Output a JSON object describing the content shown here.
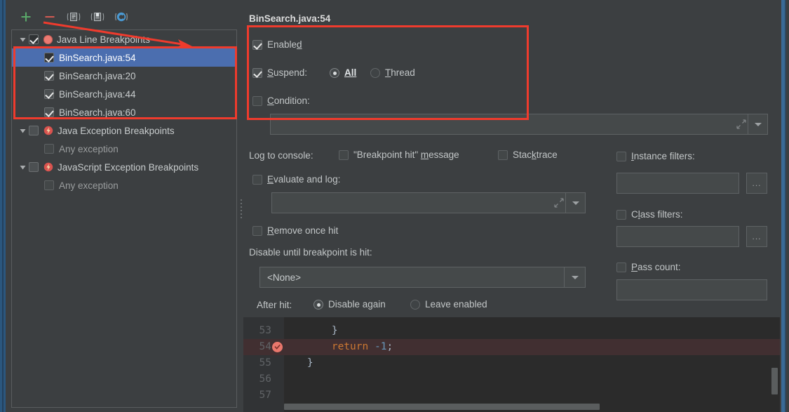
{
  "window": {
    "accent_blue": "#3a6a96",
    "background": "#3c3f41",
    "selection_blue": "#4b6eaf",
    "annotation_red": "#ef3b2d"
  },
  "toolbar": {
    "buttons": [
      {
        "name": "add-breakpoint-button",
        "icon": "plus-icon",
        "glyph": "+"
      },
      {
        "name": "remove-breakpoint-button",
        "icon": "minus-icon",
        "glyph": "−"
      },
      {
        "name": "group-by-file-button",
        "icon": "file-group-icon",
        "glyph": "▤"
      },
      {
        "name": "save-to-favorites-button",
        "icon": "favorites-icon",
        "glyph": "▥"
      },
      {
        "name": "mute-breakpoints-button",
        "icon": "mute-breakpoints-icon",
        "glyph": "Ⓒ"
      }
    ]
  },
  "tree": {
    "groups": [
      {
        "label": "Java Line Breakpoints",
        "icon": "line-breakpoint-icon",
        "checked": true,
        "expanded": true,
        "children": [
          {
            "label": "BinSearch.java:54",
            "checked": true,
            "selected": true
          },
          {
            "label": "BinSearch.java:20",
            "checked": true,
            "selected": false
          },
          {
            "label": "BinSearch.java:44",
            "checked": true,
            "selected": false
          },
          {
            "label": "BinSearch.java:60",
            "checked": true,
            "selected": false
          }
        ]
      },
      {
        "label": "Java Exception Breakpoints",
        "icon": "exception-breakpoint-icon",
        "checked": false,
        "expanded": true,
        "children": [
          {
            "label": "Any exception",
            "checked": false,
            "selected": false
          }
        ]
      },
      {
        "label": "JavaScript Exception Breakpoints",
        "icon": "exception-breakpoint-icon",
        "checked": false,
        "expanded": true,
        "children": [
          {
            "label": "Any exception",
            "checked": false,
            "selected": false
          }
        ]
      }
    ]
  },
  "config": {
    "title": "BinSearch.java:54",
    "enabled": {
      "label": "Enabled",
      "checked": true
    },
    "suspend": {
      "label": "Suspend:",
      "checked": true
    },
    "suspend_all": {
      "label": "All",
      "selected": true
    },
    "suspend_thread": {
      "label": "Thread",
      "selected": false
    },
    "condition": {
      "label": "Condition:",
      "checked": false,
      "value": ""
    },
    "log_to_console_label": "Log to console:",
    "breakpoint_hit_message": {
      "label": "\"Breakpoint hit\" message",
      "checked": false
    },
    "stacktrace": {
      "label": "Stacktrace",
      "checked": false
    },
    "evaluate_and_log": {
      "label": "Evaluate and log:",
      "checked": false,
      "value": ""
    },
    "remove_once_hit": {
      "label": "Remove once hit",
      "checked": false
    },
    "disable_until_label": "Disable until breakpoint is hit:",
    "disable_until_value": "<None>",
    "after_hit_label": "After hit:",
    "after_hit_disable_again": {
      "label": "Disable again",
      "selected": true
    },
    "after_hit_leave_enabled": {
      "label": "Leave enabled",
      "selected": false
    },
    "instance_filters": {
      "label": "Instance filters:",
      "checked": false,
      "value": "",
      "browse": "..."
    },
    "class_filters": {
      "label": "Class filters:",
      "checked": false,
      "value": "",
      "browse": "..."
    },
    "pass_count": {
      "label": "Pass count:",
      "checked": false,
      "value": ""
    }
  },
  "editor": {
    "lines": [
      {
        "number": "53",
        "code": "        }",
        "highlighted": false,
        "breakpoint": false
      },
      {
        "number": "54",
        "code": "        return -1;",
        "highlighted": true,
        "breakpoint": true
      },
      {
        "number": "55",
        "code": "    }",
        "highlighted": false,
        "breakpoint": false
      },
      {
        "number": "56",
        "code": "",
        "highlighted": false,
        "breakpoint": false
      },
      {
        "number": "57",
        "code": "",
        "highlighted": false,
        "breakpoint": false
      }
    ],
    "line54_keyword": "return",
    "line54_number": "-1",
    "line54_semicolon": ";"
  },
  "annotations": {
    "tree_box_label": "highlight around Java line breakpoint entries",
    "config_box_label": "highlight around enabled/suspend/condition options",
    "arrow_label": "arrow pointing to Java Line Breakpoints group"
  }
}
